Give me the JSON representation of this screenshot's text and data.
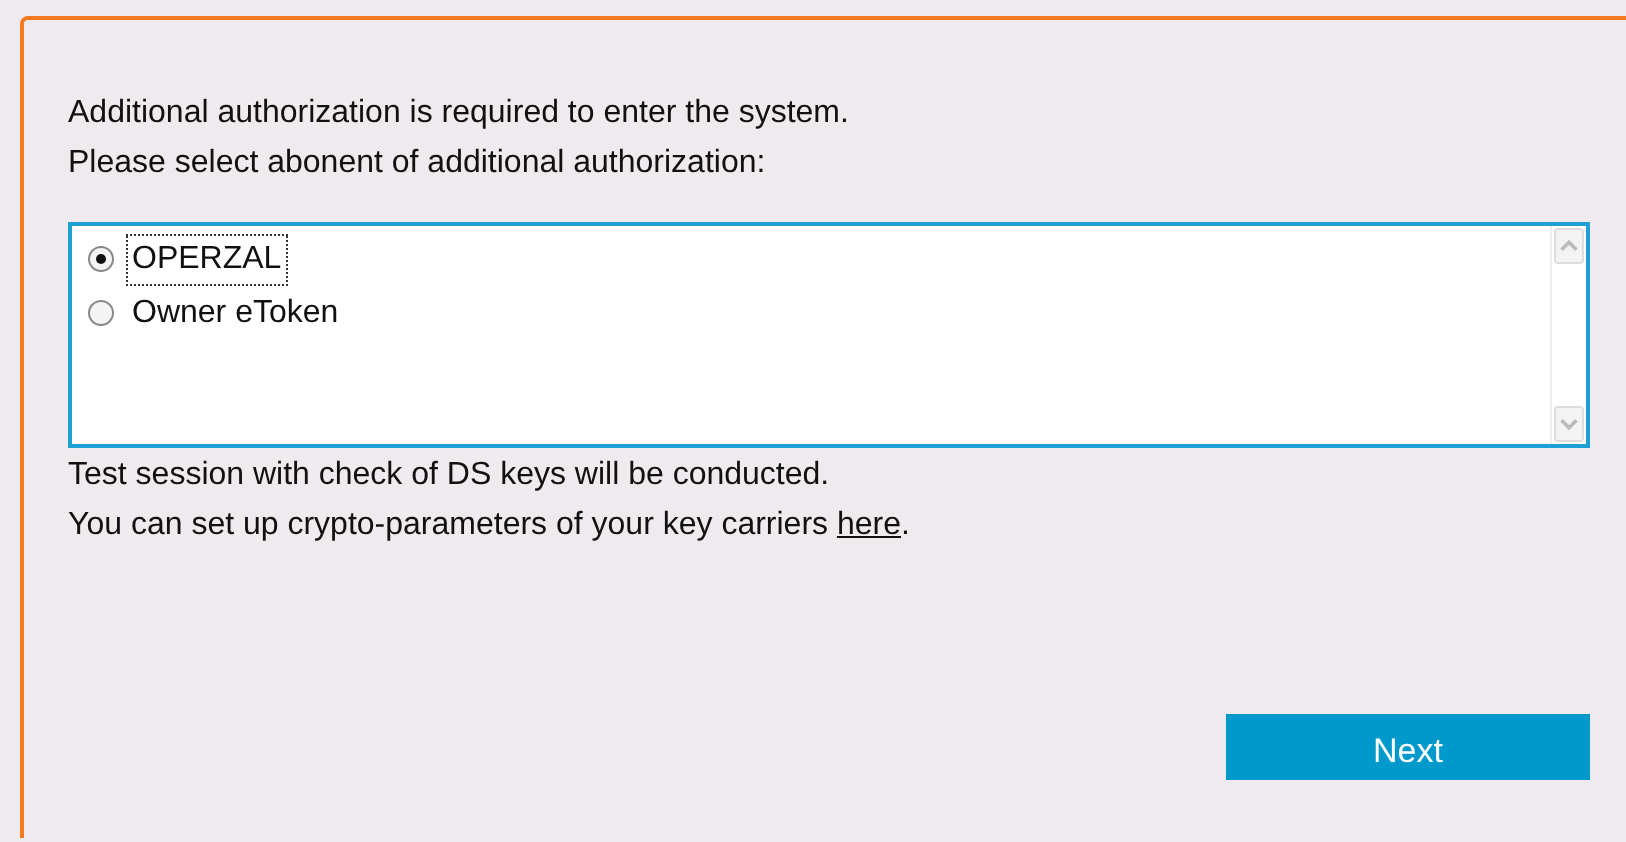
{
  "intro_lines": [
    "Additional authorization is required to enter the system.",
    "Please select abonent of additional authorization:"
  ],
  "abonents": [
    {
      "label": "OPERZAL",
      "selected": true
    },
    {
      "label": "Owner eToken",
      "selected": false
    }
  ],
  "info_lines": [
    "Test session with check of DS keys will be conducted."
  ],
  "crypto_line": {
    "text": "You can set up crypto-parameters of your key carriers ",
    "link": "here",
    "after": "."
  },
  "next_button": "Next"
}
